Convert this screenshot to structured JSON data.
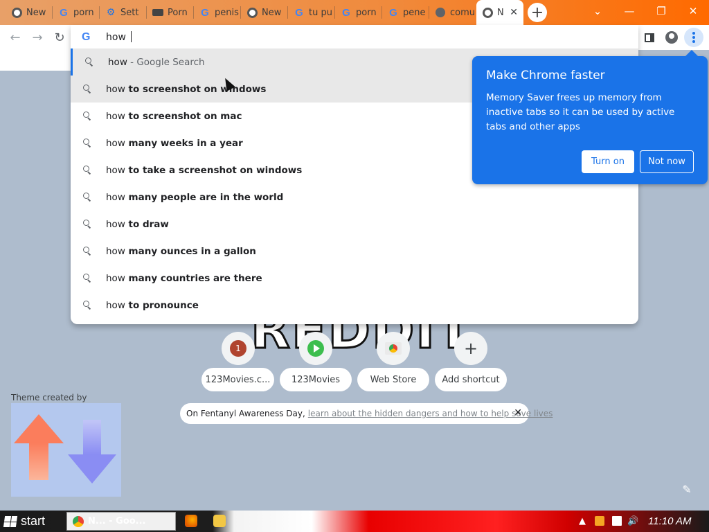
{
  "tabs": [
    {
      "label": "New",
      "icon": "chrome-icon"
    },
    {
      "label": "porn",
      "icon": "google-icon"
    },
    {
      "label": "Sett",
      "icon": "gear-icon"
    },
    {
      "label": "Porn",
      "icon": "image-icon"
    },
    {
      "label": "penis",
      "icon": "google-icon"
    },
    {
      "label": "New",
      "icon": "chrome-icon"
    },
    {
      "label": "tu pu",
      "icon": "google-icon"
    },
    {
      "label": "porn",
      "icon": "google-icon"
    },
    {
      "label": "pene",
      "icon": "google-icon"
    },
    {
      "label": "comu",
      "icon": "globe-icon"
    },
    {
      "label": "N",
      "icon": "chrome-icon",
      "active": true
    }
  ],
  "active_tab_close": "✕",
  "new_tab_symbol": "+",
  "window_controls": {
    "dropdown": "⌄",
    "minimize": "—",
    "restore": "❐",
    "close": "✕"
  },
  "toolbar": {
    "back": "←",
    "forward": "→",
    "reload": "↻"
  },
  "omnibox": {
    "g_letter": "G",
    "typed": "how ",
    "suggestions": [
      {
        "prefix": "how",
        "rest": " - Google Search",
        "type": "search-what-you-typed"
      },
      {
        "prefix": "how",
        "rest": " to screenshot on windows"
      },
      {
        "prefix": "how",
        "rest": " to screenshot on mac"
      },
      {
        "prefix": "how",
        "rest": " many weeks in a year"
      },
      {
        "prefix": "how",
        "rest": " to take a screenshot on windows"
      },
      {
        "prefix": "how",
        "rest": " many people are in the world"
      },
      {
        "prefix": "how",
        "rest": " to draw"
      },
      {
        "prefix": "how",
        "rest": " many ounces in a gallon"
      },
      {
        "prefix": "how",
        "rest": " many countries are there"
      },
      {
        "prefix": "how",
        "rest": " to pronounce"
      }
    ]
  },
  "promo": {
    "title": "Make Chrome faster",
    "body": "Memory Saver frees up memory from inactive tabs so it can be used by active tabs and other apps",
    "turn_on": "Turn on",
    "not_now": "Not now"
  },
  "ntp": {
    "logo_text": "REDDIT",
    "shortcuts": [
      {
        "label": "123Movies.c...",
        "icon": "123movies-icon",
        "badge": "1"
      },
      {
        "label": "123Movies",
        "icon": "play-icon"
      },
      {
        "label": "Web Store",
        "icon": "webstore-icon"
      },
      {
        "label": "Add shortcut",
        "icon": "plus-icon",
        "symbol": "+"
      }
    ],
    "notice_text": "On Fentanyl Awareness Day,",
    "notice_link": "learn about the hidden dangers and how to help save lives",
    "notice_close": "✕",
    "theme_credit": "Theme created by",
    "edit_icon": "✎"
  },
  "taskbar": {
    "start_label": "start",
    "active_app_label": "N... - Goo...",
    "clock": "11:10 AM",
    "tray_arrow": "▲"
  },
  "colors": {
    "promo_blue": "#1a73e8",
    "tabstrip_start": "#e8a068",
    "tabstrip_end": "#ff6a00",
    "ntp_background": "#aebccd"
  }
}
